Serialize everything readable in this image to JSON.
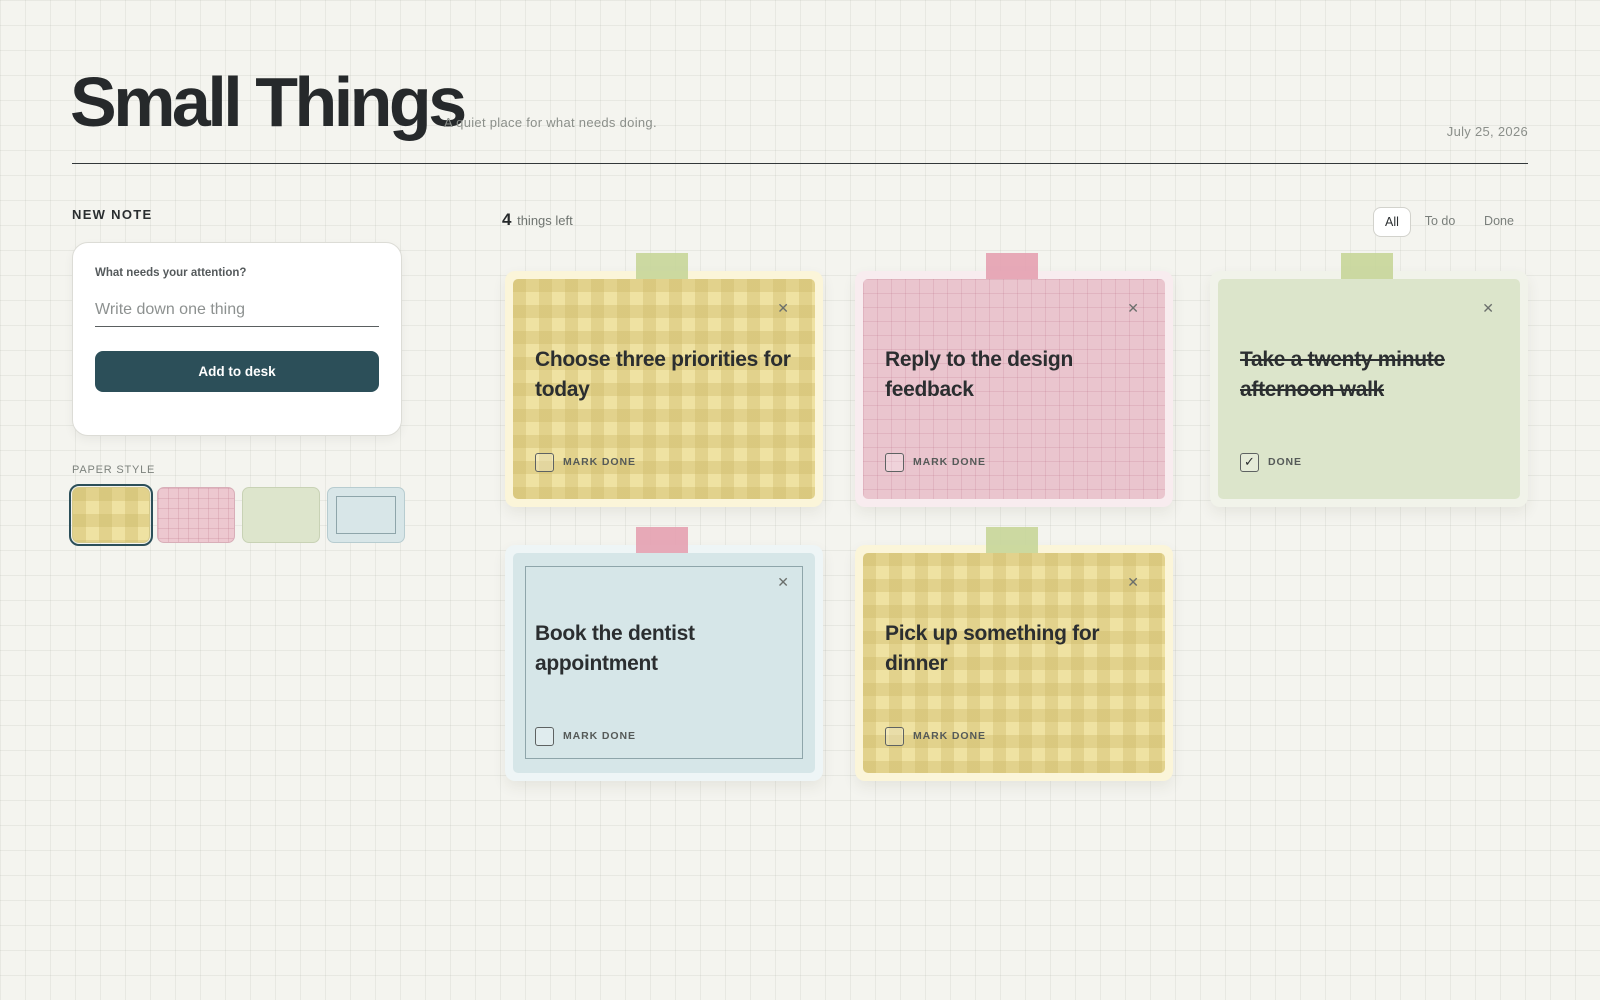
{
  "header": {
    "title": "Small Things",
    "tagline": "A quiet place for what needs doing.",
    "date": "July 25, 2026"
  },
  "new_note": {
    "section_label": "NEW NOTE",
    "field_label": "What needs your attention?",
    "placeholder": "Write down one thing",
    "value": "",
    "button_label": "Add to desk"
  },
  "paper_style": {
    "label": "PAPER STYLE",
    "options": [
      "yellow-gingham",
      "pink-grid",
      "green-plain",
      "blue-framed"
    ],
    "selected": "yellow-gingham"
  },
  "board": {
    "count": "4",
    "count_label": "things left",
    "filters": {
      "all": "All",
      "todo": "To do",
      "done": "Done",
      "active": "All"
    }
  },
  "notes": [
    {
      "text": "Choose three priorities for today",
      "style": "yellow",
      "tape": "green",
      "done": false,
      "check_label": "MARK DONE"
    },
    {
      "text": "Reply to the design feedback",
      "style": "pink",
      "tape": "pink",
      "done": false,
      "check_label": "MARK DONE"
    },
    {
      "text": "Take a twenty minute afternoon walk",
      "style": "green",
      "tape": "green",
      "done": true,
      "check_label": "DONE"
    },
    {
      "text": "Book the dentist appointment",
      "style": "blue",
      "tape": "pink",
      "done": false,
      "check_label": "MARK DONE"
    },
    {
      "text": "Pick up something for dinner",
      "style": "yellow",
      "tape": "green",
      "done": false,
      "check_label": "MARK DONE"
    }
  ],
  "icons": {
    "close": "close-icon",
    "check": "checkmark-icon"
  },
  "colors": {
    "accent": "#2c4f59",
    "tape_green": "#c8d69a",
    "tape_pink": "#e5a2b2"
  }
}
